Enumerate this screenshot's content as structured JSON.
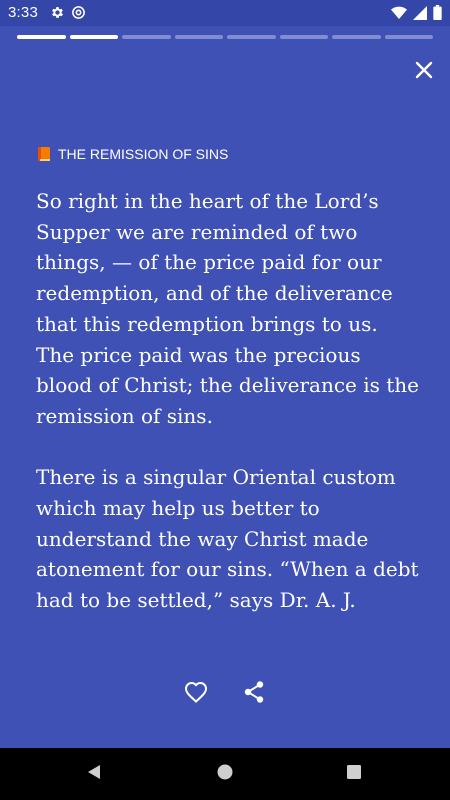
{
  "status_bar": {
    "time": "3:33",
    "left_icons": [
      "settings-icon",
      "at-sign-icon"
    ],
    "right_icons": [
      "wifi-icon",
      "cell-signal-icon",
      "battery-icon"
    ]
  },
  "story_progress": {
    "total_segments": 8,
    "completed_segments": 2
  },
  "reader": {
    "book_icon": "book-icon",
    "book_color": "#F57C00",
    "section_title": "THE REMISSION OF SINS",
    "paragraphs": [
      "So right in the heart of the Lord’s Supper we are reminded of two things, — of the price paid for our redemption, and of the deliverance that this redemption brings to us. The price paid was the precious blood of Christ; the deliverance is the remission of sins.",
      "There is a singular Oriental custom which may help us better to understand the way Christ made atonement for our sins. “When a debt had to be settled,” says Dr. A. J."
    ]
  },
  "actions": {
    "like_icon": "heart-outline-icon",
    "share_icon": "share-icon"
  },
  "navigation": {
    "back_icon": "back-triangle-icon",
    "home_icon": "home-circle-icon",
    "recents_icon": "recents-square-icon"
  },
  "colors": {
    "background": "#3F51B5",
    "status_bar": "#3446A8",
    "text": "#FFFFFF",
    "nav_bar": "#000000"
  }
}
